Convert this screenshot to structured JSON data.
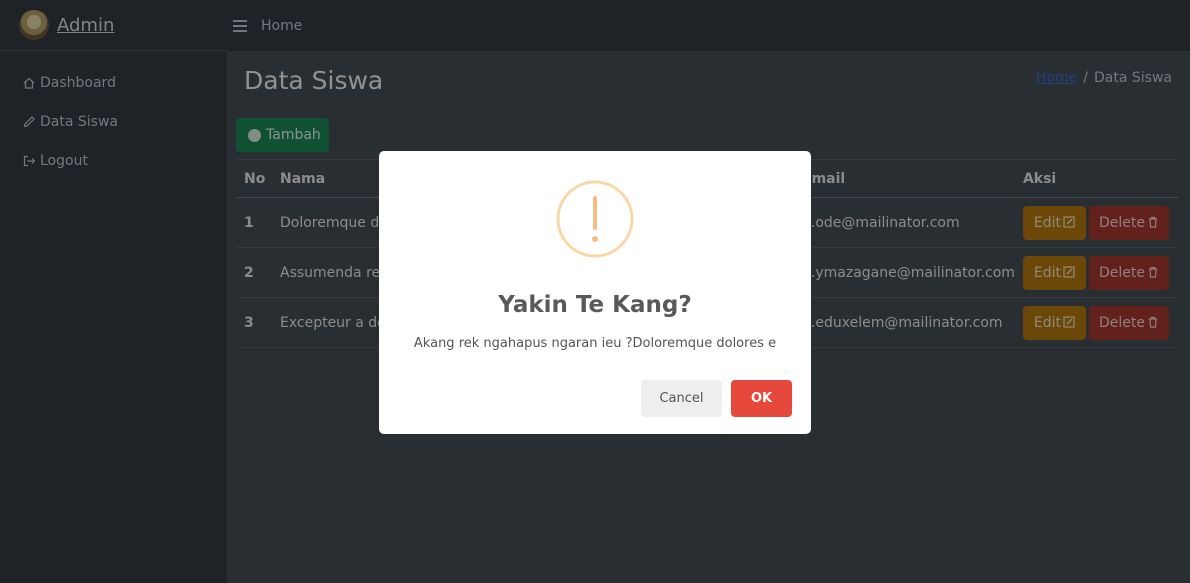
{
  "sidebar": {
    "brand": "Admin",
    "items": [
      {
        "label": "Dashboard",
        "icon": "house-icon"
      },
      {
        "label": "Data Siswa",
        "icon": "pencil-icon"
      },
      {
        "label": "Logout",
        "icon": "logout-icon"
      }
    ]
  },
  "topbar": {
    "home": "Home"
  },
  "page": {
    "title": "Data Siswa",
    "breadcrumb": {
      "home": "Home",
      "separator": "/",
      "current": "Data Siswa"
    },
    "add_button": "Tambah"
  },
  "table": {
    "headers": [
      "No",
      "Nama",
      "Email",
      "Aksi"
    ],
    "rows": [
      {
        "no": "1",
        "nama": "Doloremque dolores e",
        "email": "...ode@mailinator.com"
      },
      {
        "no": "2",
        "nama": "Assumenda rec",
        "email": "...ymazagane@mailinator.com"
      },
      {
        "no": "3",
        "nama": "Excepteur a del",
        "email": "...eduxelem@mailinator.com"
      }
    ],
    "edit_label": "Edit",
    "delete_label": "Delete"
  },
  "modal": {
    "title": "Yakin Te Kang?",
    "text": "Akang rek ngahapus ngaran ieu ?Doloremque dolores e",
    "cancel": "Cancel",
    "ok": "OK"
  },
  "colors": {
    "sidebar": "#343a40",
    "content": "#454d55",
    "success": "#198754",
    "warning": "#b5790e",
    "danger": "#a6372f",
    "modal_ok": "#e6483c",
    "warn_icon": "#f8bb86"
  }
}
